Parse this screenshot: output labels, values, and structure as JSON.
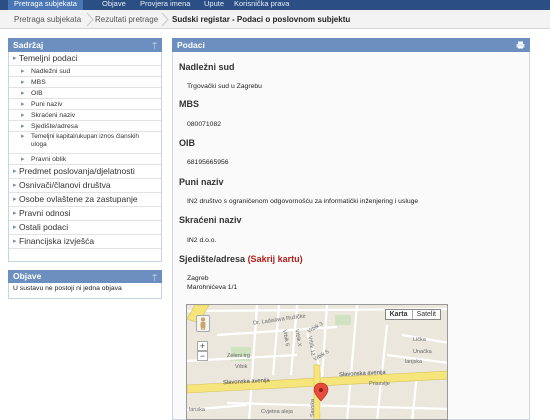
{
  "topnav": {
    "tabs": [
      {
        "label": "Pretraga subjekata",
        "active": true
      },
      {
        "label": "Objave",
        "active": false
      },
      {
        "label": "Provjera imena",
        "active": false
      },
      {
        "label": "Upute",
        "active": false
      },
      {
        "label": "Korisnička prava",
        "active": false
      }
    ]
  },
  "breadcrumb": {
    "items": [
      "Pretraga subjekata",
      "Rezultati pretrage"
    ],
    "current": "Sudski registar - Podaci o poslovnom subjektu"
  },
  "sidebar": {
    "title": "Sadržaj",
    "items": [
      {
        "label": "Temeljni podaci"
      },
      {
        "label": "Nadležni sud"
      },
      {
        "label": "MBS"
      },
      {
        "label": "OIB"
      },
      {
        "label": "Puni naziv"
      },
      {
        "label": "Skraćeni naziv"
      },
      {
        "label": "Sjedište/adresa"
      },
      {
        "label": "Temeljni kapital/ukupan iznos članskih uloga"
      },
      {
        "label": "Pravni oblik"
      },
      {
        "label": "Predmet poslovanja/djelatnosti"
      },
      {
        "label": "Osnivači/članovi društva"
      },
      {
        "label": "Osobe ovlaštene za zastupanje"
      },
      {
        "label": "Pravni odnosi"
      },
      {
        "label": "Ostali podaci"
      },
      {
        "label": "Financijska izvješća"
      }
    ]
  },
  "objave": {
    "title": "Objave",
    "text": "U sustavu ne postoji ni jedna objava"
  },
  "main": {
    "title": "Podaci",
    "fields": [
      {
        "label": "Nadležni sud",
        "value": "Trgovački sud u Zagrebu"
      },
      {
        "label": "MBS",
        "value": "080071082"
      },
      {
        "label": "OIB",
        "value": "68195665956"
      },
      {
        "label": "Puni naziv",
        "value": "IN2 društvo s ograničenom odgovornošću za informatički inženjering i usluge"
      },
      {
        "label": "Skraćeni naziv",
        "value": "IN2 d.o.o."
      }
    ],
    "address_label": "Sjedište/adresa",
    "hide_map_link": "(Sakrij kartu)",
    "city": "Zagreb",
    "street": "Marohnićeva 1/1"
  },
  "map": {
    "type_map": "Karta",
    "type_satellite": "Satelit",
    "labels": {
      "dr_ruzica": "Dr. Ladislava Ružičke",
      "zeleni_trg": "Zeleni trg",
      "vrbik": "Vrbik",
      "vrbik6": "Vrbik 6",
      "vrbik_x": "Vrbik X",
      "vrbik_12": "Vrbik 12",
      "vrbik_3": "Vrbik 3",
      "vrbik_5": "Vrbik 5",
      "slavonska_1": "Slavonska avenija",
      "slavonska_2": "Slavonska avenija",
      "prisavlje": "Prisavlje",
      "licka": "Lička",
      "unacka": "Unačka",
      "lanjska": "lanjska",
      "savska": "Savska",
      "cvjetna": "Cvjetna aleja",
      "lanska": "lanska"
    }
  }
}
